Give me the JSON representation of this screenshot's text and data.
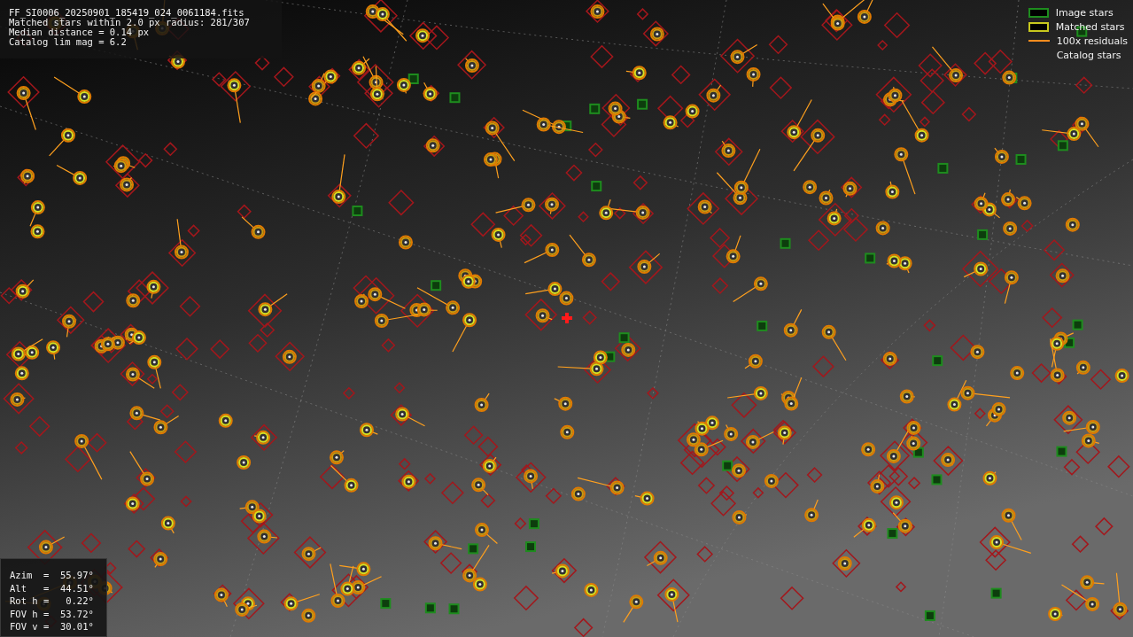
{
  "info_panel": {
    "lines": [
      "FF_SI0006_20250901_185419_024_0061184.fits",
      "Matched stars within 2.0 px radius: 281/307",
      "Median distance = 0.14 px",
      "Catalog lim mag = 6.2"
    ]
  },
  "legend": [
    {
      "kind": "box",
      "color": "#1e8c1e",
      "label": "Image stars"
    },
    {
      "kind": "box",
      "color": "#c8c81e",
      "label": "Matched stars"
    },
    {
      "kind": "line",
      "color": "#ff8c1e",
      "label": "100x residuals"
    },
    {
      "kind": "blank",
      "label": "Catalog stars"
    }
  ],
  "pointing_panel": {
    "rows": [
      "Azim  =  55.97°",
      "Alt   =  44.51°",
      "Rot h =   0.22°",
      "FOV h =  53.72°",
      "FOV v =  30.01°"
    ]
  }
}
